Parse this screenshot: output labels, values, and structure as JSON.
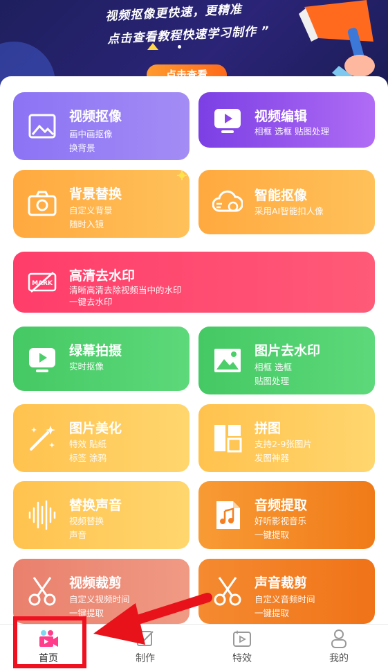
{
  "banner": {
    "line1": "视频抠像更快速，更精准",
    "line2": "点击查看教程快速学习制作 ”",
    "cta": "点击查看"
  },
  "cards": [
    {
      "title": "视频抠像",
      "sub1": "画中画抠像",
      "sub2": "换背景",
      "icon": "image-frame-icon"
    },
    {
      "title": "视频编辑",
      "sub1": "相框 选框 贴图处理",
      "sub2": "",
      "icon": "video-play-icon"
    },
    {
      "title": "背景替换",
      "sub1": "自定义背景",
      "sub2": "随时入镜",
      "icon": "camera-icon"
    },
    {
      "title": "智能抠像",
      "sub1": "采用AI智能扣人像",
      "sub2": "",
      "icon": "ai-cloud-icon"
    },
    {
      "title": "高清去水印",
      "sub1": "清晰高清去除视频当中的水印",
      "sub2": "一键去水印",
      "icon": "mark-remove-icon",
      "icon_text": "MARK"
    },
    {
      "title": "绿幕拍摄",
      "sub1": "实时抠像",
      "sub2": "",
      "icon": "video-play-icon"
    },
    {
      "title": "图片去水印",
      "sub1": "相框 选框",
      "sub2": "贴图处理",
      "icon": "picture-icon"
    },
    {
      "title": "图片美化",
      "sub1": "特效 贴纸",
      "sub2": "标签 涂鸦",
      "icon": "magic-wand-icon"
    },
    {
      "title": "拼图",
      "sub1": "支持2-9张图片",
      "sub2": "发图神器",
      "icon": "collage-icon"
    },
    {
      "title": "替换声音",
      "sub1": "视频替换",
      "sub2": "声音",
      "icon": "sound-wave-icon"
    },
    {
      "title": "音频提取",
      "sub1": "好听影视音乐",
      "sub2": "一键提取",
      "icon": "music-file-icon"
    },
    {
      "title": "视频裁剪",
      "sub1": "自定义视频时间",
      "sub2": "一键提取",
      "icon": "scissors-icon"
    },
    {
      "title": "声音裁剪",
      "sub1": "自定义音频时间",
      "sub2": "一键提取",
      "icon": "scissors-icon"
    }
  ],
  "tabs": [
    {
      "label": "首页",
      "icon": "home-camera-icon",
      "active": true
    },
    {
      "label": "制作",
      "icon": "edit-icon",
      "active": false
    },
    {
      "label": "特效",
      "icon": "effects-icon",
      "active": false
    },
    {
      "label": "我的",
      "icon": "profile-icon",
      "active": false
    }
  ],
  "colors": {
    "banner_bg": "#1e1f5e",
    "cta": "#ff7a22",
    "highlight": "#ef1020",
    "purple": "#9c7bf2",
    "violet": "#8a46e8",
    "orange": "#ffb64a",
    "pink": "#ff4a6e",
    "green": "#4ccf6a",
    "yellow": "#ffcf5a",
    "deep_orange": "#f57f20",
    "salmon": "#ec8b78"
  }
}
